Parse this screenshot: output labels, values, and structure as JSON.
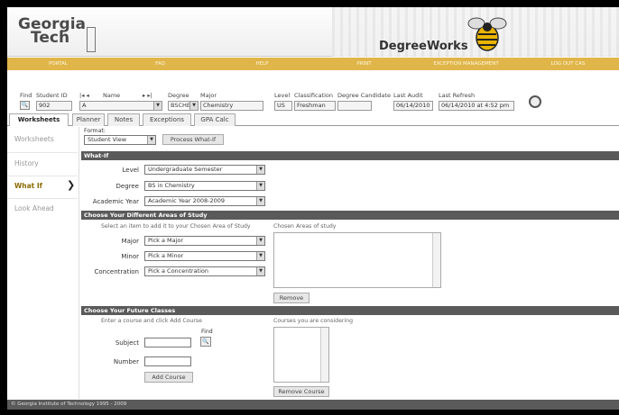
{
  "header": {
    "logo_line1": "Georgia",
    "logo_line2": "Tech",
    "app_title": "DegreeWorks"
  },
  "nav": [
    "PORTAL",
    "FAQ",
    "HELP",
    "PRINT",
    "EXCEPTION MANAGEMENT",
    "LOG OUT CAS"
  ],
  "student": {
    "find_label": "Find",
    "id_label": "Student ID",
    "id_value": "902",
    "name_label": "Name",
    "name_value": "A",
    "degree_label": "Degree",
    "degree_value": "BSCHE",
    "major_label": "Major",
    "major_value": "Chemistry",
    "level_label": "Level",
    "level_value": "US",
    "class_label": "Classification",
    "class_value": "Freshman",
    "candidate_label": "Degree Candidate",
    "candidate_value": "",
    "audit_label": "Last Audit",
    "audit_value": "06/14/2010",
    "refresh_label": "Last Refresh",
    "refresh_value": "06/14/2010 at 4:52 pm"
  },
  "tabs": [
    "Worksheets",
    "Planner",
    "Notes",
    "Exceptions",
    "GPA Calc"
  ],
  "leftnav": [
    "Worksheets",
    "History",
    "What If",
    "Look Ahead"
  ],
  "format": {
    "label": "Format:",
    "value": "Student View",
    "button": "Process What-If"
  },
  "whatif": {
    "title": "What-If",
    "level_label": "Level",
    "level_value": "Undergraduate Semester",
    "degree_label": "Degree",
    "degree_value": "BS in Chemistry",
    "year_label": "Academic Year",
    "year_value": "Academic Year 2008-2009"
  },
  "areas": {
    "title": "Choose Your Different Areas of Study",
    "hint": "Select an item to add it to your Chosen Area of Study",
    "chosen_label": "Chosen Areas of study",
    "major_label": "Major",
    "major_value": "Pick a Major",
    "minor_label": "Minor",
    "minor_value": "Pick a Minor",
    "conc_label": "Concentration",
    "conc_value": "Pick a Concentration",
    "remove_button": "Remove"
  },
  "future": {
    "title": "Choose Your Future Classes",
    "hint": "Enter a course and click Add Course",
    "considering_label": "Courses you are considering",
    "subject_label": "Subject",
    "number_label": "Number",
    "find_label": "Find",
    "add_button": "Add Course",
    "remove_button": "Remove Course"
  },
  "footer": "© Georgia Institute of Technology 1995 - 2009"
}
